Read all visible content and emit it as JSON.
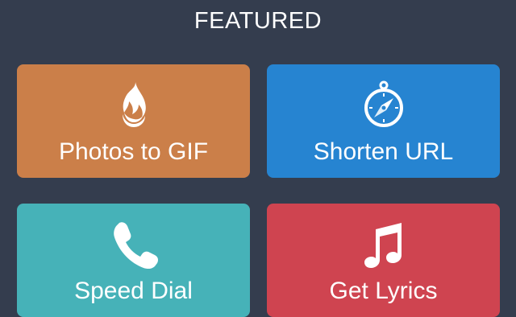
{
  "header": {
    "title": "FEATURED"
  },
  "tiles": [
    {
      "label": "Photos to GIF",
      "icon": "flame-icon",
      "color": "#cb7f49"
    },
    {
      "label": "Shorten URL",
      "icon": "compass-icon",
      "color": "#2684d1"
    },
    {
      "label": "Speed Dial",
      "icon": "phone-icon",
      "color": "#46b2b8"
    },
    {
      "label": "Get Lyrics",
      "icon": "music-note-icon",
      "color": "#cf4450"
    }
  ]
}
